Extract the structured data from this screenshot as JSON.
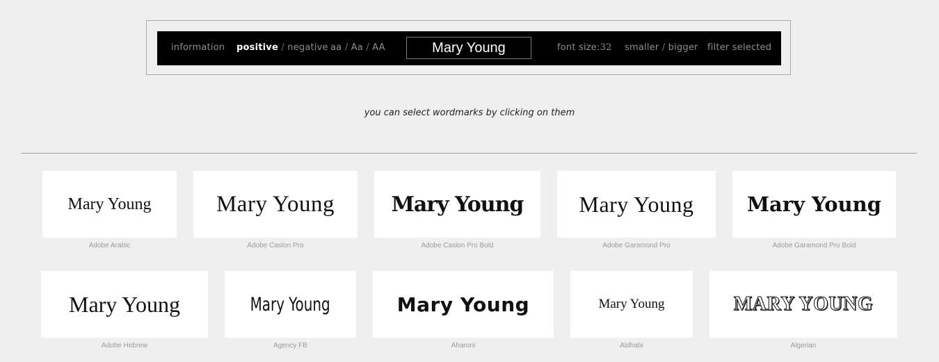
{
  "toolbar": {
    "information": "information",
    "positive": "positive",
    "slash": "/",
    "negative": "negative",
    "case_lower": "aa",
    "case_title": "Aa",
    "case_upper": "AA",
    "name_value": "Mary Young",
    "font_size_label": "font size:",
    "font_size_value": "32",
    "smaller": "smaller",
    "bigger": "bigger",
    "filter": "filter selected"
  },
  "hint": "you can select wordmarks by clicking on them",
  "wordmark_text": "Mary Young",
  "fonts": [
    {
      "name": "Adobe Arabic"
    },
    {
      "name": "Adobe Caslon Pro"
    },
    {
      "name": "Adobe Caslon Pro Bold"
    },
    {
      "name": "Adobe Garamond Pro"
    },
    {
      "name": "Adobe Garamond Pro Bold"
    },
    {
      "name": "Adobe Hebrew"
    },
    {
      "name": "Agency FB"
    },
    {
      "name": "Aharoni"
    },
    {
      "name": "Aldhabi"
    },
    {
      "name": "Algerian"
    }
  ]
}
